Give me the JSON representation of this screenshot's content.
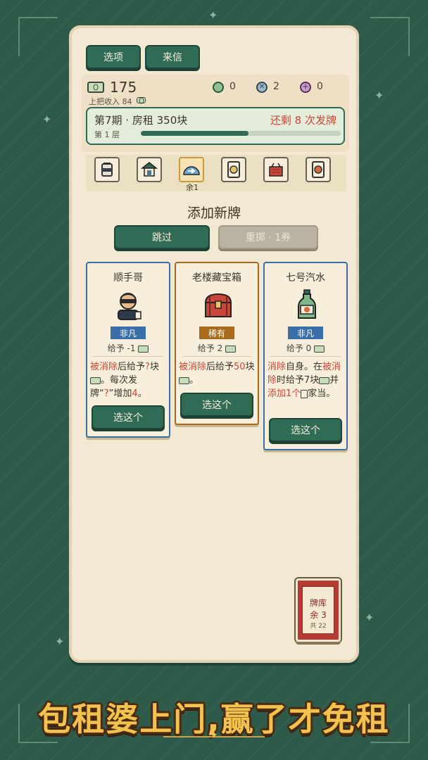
{
  "top_buttons": {
    "options_label": "选项",
    "letters_label": "来信"
  },
  "status": {
    "money": "175",
    "last_income": "上把收入 84",
    "resources": [
      {
        "icon": "green-token-icon",
        "value": "0"
      },
      {
        "icon": "blue-remove-token-icon",
        "value": "2"
      },
      {
        "icon": "purple-add-token-icon",
        "value": "0"
      }
    ],
    "period": "第7期 · 房租 350块",
    "remaining": "还剩 8 次发牌",
    "floor": "第 1 层",
    "progress": 0.54
  },
  "relics": {
    "items": [
      "jar-icon",
      "house-icon",
      "dome-arrow-icon",
      "card-8-icon",
      "basket-icon",
      "card-7-icon"
    ],
    "dome_note": "余1"
  },
  "section_title": "添加新牌",
  "actions": {
    "skip_label": "跳过",
    "reroll_label": "重掷 · 1券"
  },
  "cards": [
    {
      "name": "顺手哥",
      "icon": "masked-thief-icon",
      "rarity": "非凡",
      "give": "给予 -1",
      "desc": {
        "t1": "被消除",
        "t2": "后给予",
        "t3": "?",
        "t4": "块",
        "t5": "。每次发牌“",
        "t6": "?",
        "t7": "”增加",
        "t8": "4",
        "t9": "。"
      },
      "select_label": "选这个"
    },
    {
      "name": "老楼藏宝箱",
      "icon": "treasure-chest-icon",
      "rarity": "稀有",
      "give": "给予 2",
      "desc": {
        "t1": "被消除",
        "t2": "后给予",
        "t3": "50",
        "t4": "块",
        "t5": "。"
      },
      "select_label": "选这个"
    },
    {
      "name": "七号汽水",
      "icon": "soda-bottle-icon",
      "rarity": "非凡",
      "give": "给予 0",
      "desc": {
        "t1": "消除",
        "t2": "自身。在",
        "t3": "被消除",
        "t4": "时给予7块",
        "t5": "并",
        "t6": "添加1个",
        "t7": "家当。"
      },
      "select_label": "选这个"
    }
  ],
  "deck": {
    "label_line1": "牌库",
    "label_line2": "余 3",
    "total": "共 22"
  },
  "slogan": "包租婆上门,赢了才免租",
  "colors": {
    "accent_green": "#2f6b55",
    "panel": "#f3e9d2",
    "red_text": "#c8473a",
    "rare_gold": "#a86b1e",
    "uncommon_blue": "#3a6ea8"
  }
}
